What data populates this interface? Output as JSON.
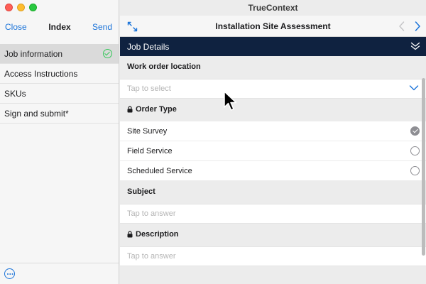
{
  "window": {
    "title": "TrueContext"
  },
  "sidebar": {
    "close_label": "Close",
    "title": "Index",
    "send_label": "Send",
    "items": [
      {
        "label": "Job information",
        "selected": true,
        "complete": true
      },
      {
        "label": "Access Instructions"
      },
      {
        "label": "SKUs"
      },
      {
        "label": "Sign and submit*"
      }
    ],
    "footer_icon": "more-icon"
  },
  "main": {
    "form_title": "Installation Site Assessment",
    "section": {
      "label": "Job Details",
      "icon": "double-chevron-down-icon"
    },
    "questions": {
      "work_order": {
        "label": "Work order location",
        "placeholder": "Tap to select"
      },
      "order_type": {
        "label": "Order Type",
        "locked": true,
        "options": [
          {
            "label": "Site Survey",
            "selected": true
          },
          {
            "label": "Field Service",
            "selected": false
          },
          {
            "label": "Scheduled Service",
            "selected": false
          }
        ]
      },
      "subject": {
        "label": "Subject",
        "placeholder": "Tap to answer"
      },
      "description": {
        "label": "Description",
        "locked": true,
        "placeholder": "Tap to answer"
      }
    }
  },
  "colors": {
    "accent": "#1a73d9",
    "section_bar": "#0f2240",
    "complete_check": "#34c759"
  }
}
